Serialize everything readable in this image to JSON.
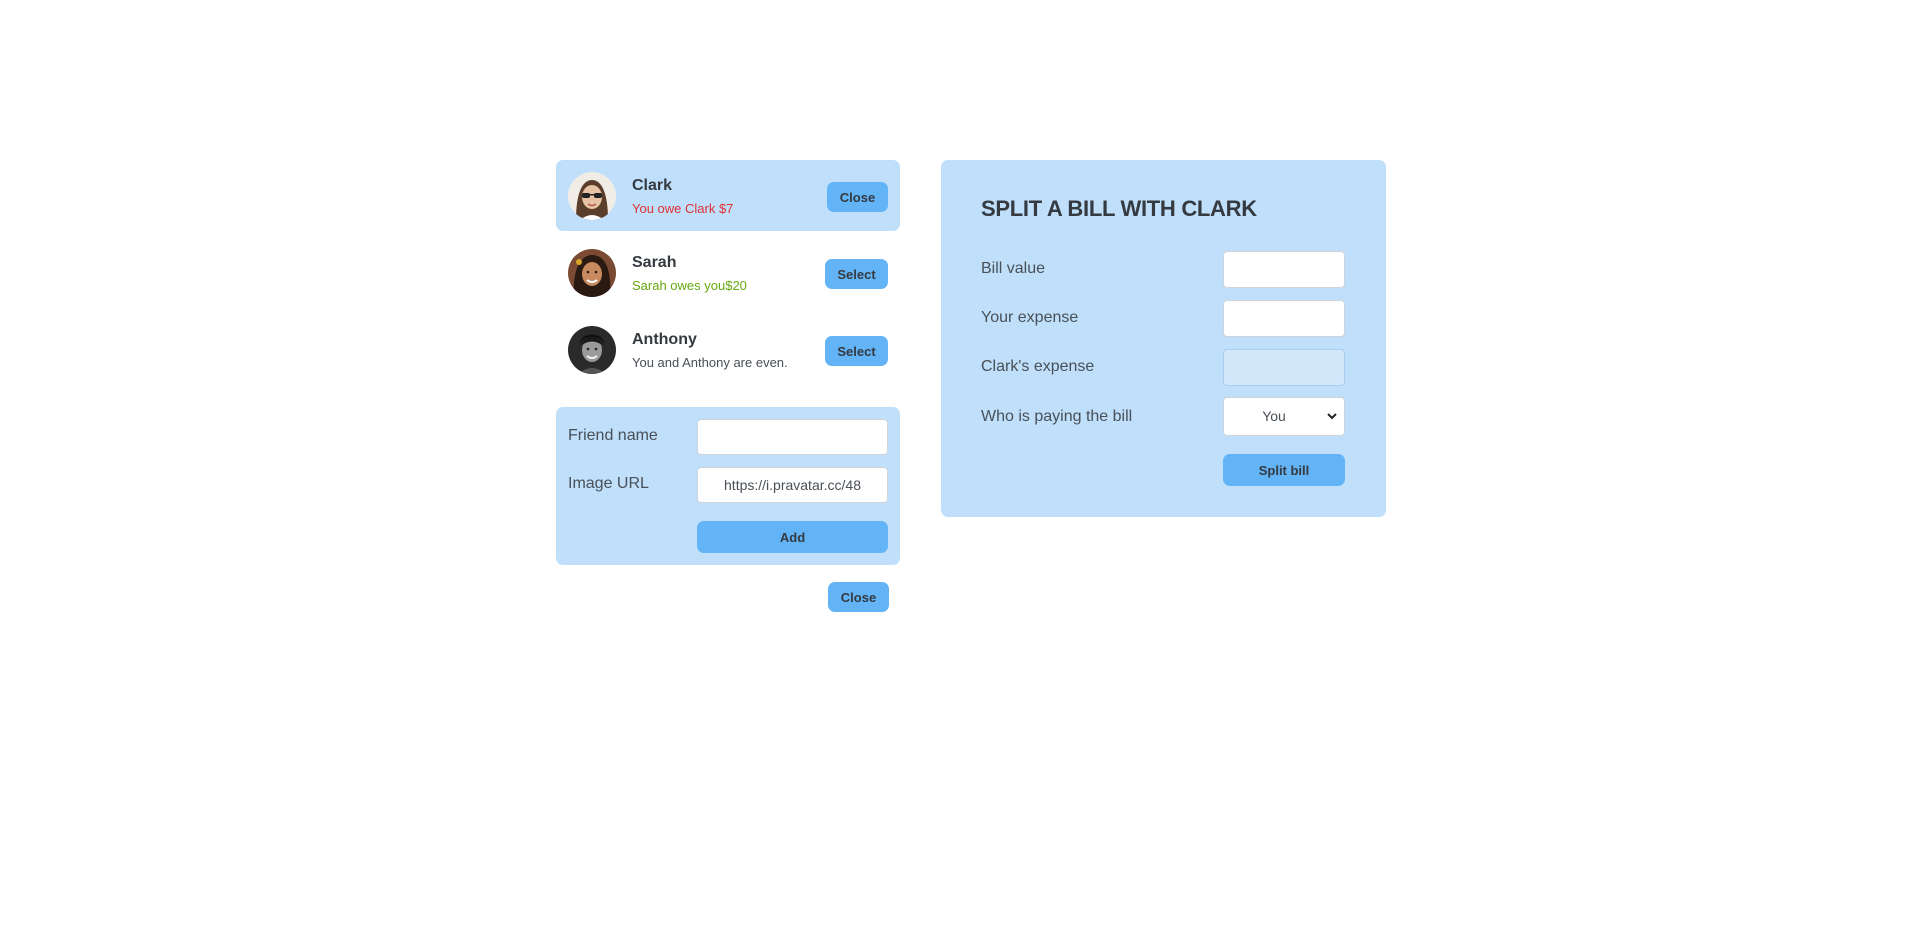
{
  "friends": [
    {
      "name": "Clark",
      "balance_text": "You owe Clark $7",
      "button_label": "Close",
      "selected": true
    },
    {
      "name": "Sarah",
      "balance_text": "Sarah owes you$20",
      "button_label": "Select",
      "selected": false
    },
    {
      "name": "Anthony",
      "balance_text": "You and Anthony are even.",
      "button_label": "Select",
      "selected": false
    }
  ],
  "add_friend": {
    "name_label": "Friend name",
    "name_value": "",
    "image_label": "Image URL",
    "image_value": "https://i.pravatar.cc/48",
    "add_label": "Add"
  },
  "close_add_label": "Close",
  "split": {
    "title": "SPLIT A BILL WITH CLARK",
    "bill_label": "Bill value",
    "bill_value": "",
    "your_expense_label": "Your expense",
    "your_expense_value": "",
    "friend_expense_label": "Clark's expense",
    "friend_expense_value": "",
    "payer_label": "Who is paying the bill",
    "payer_value": "You",
    "submit_label": "Split bill"
  },
  "colors": {
    "panel_bg": "#bfdffb",
    "button_bg": "#63b3f7",
    "owe_red": "#e03131",
    "owed_green": "#66a80f"
  }
}
